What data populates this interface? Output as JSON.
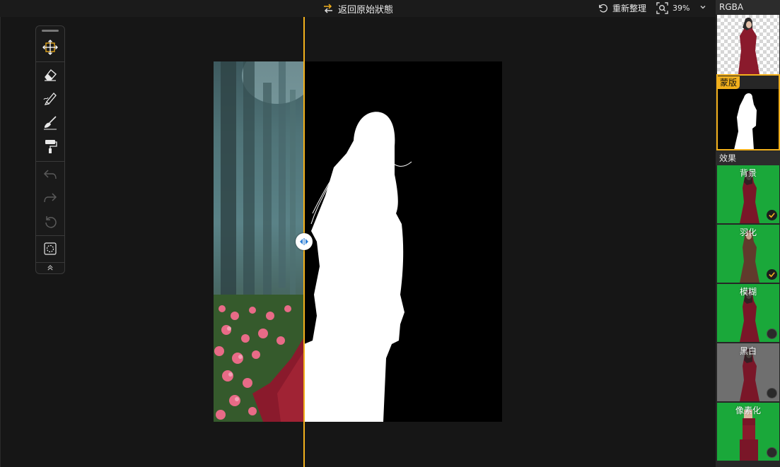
{
  "topbar": {
    "restore_label": "返回原始狀態",
    "reprocess_label": "重新整理",
    "zoom_value": "39%"
  },
  "right_panel": {
    "rgba_label": "RGBA",
    "mask_label": "蒙版",
    "effects_label": "效果",
    "effects": [
      {
        "name": "背景",
        "enabled": true
      },
      {
        "name": "羽化",
        "enabled": true
      },
      {
        "name": "模糊",
        "enabled": false
      },
      {
        "name": "黑白",
        "enabled": false
      },
      {
        "name": "像素化",
        "enabled": false
      }
    ]
  },
  "colors": {
    "accent": "#f2b01c",
    "effect_green": "#1aa83a",
    "panel_bg": "#262626"
  },
  "icons": {
    "restore": "swap-arrows-icon",
    "reprocess": "refresh-icon",
    "zoom": "zoom-fit-icon",
    "toolbar": [
      "move-icon",
      "eraser-icon",
      "brush-icon",
      "sweep-brush-icon",
      "paint-roller-icon",
      "undo-icon",
      "redo-icon",
      "reset-icon",
      "lasso-select-icon",
      "collapse-icon"
    ]
  }
}
